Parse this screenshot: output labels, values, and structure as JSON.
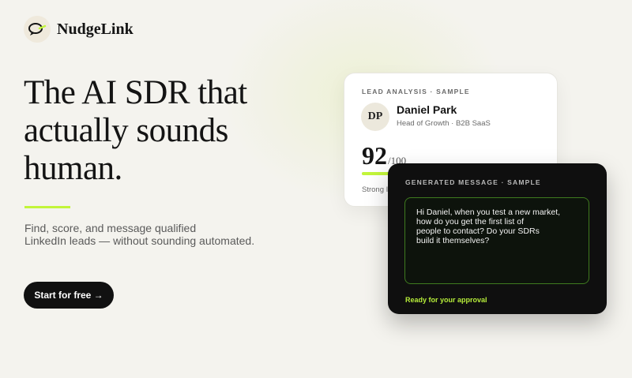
{
  "brand": {
    "name": "NudgeLink",
    "logo_icon": "chat-bubble-icon",
    "accent": "#c2f53a"
  },
  "hero": {
    "headline_lines": [
      "The AI SDR that",
      "actually sounds",
      "human."
    ],
    "subhead_lines": [
      "Find, score, and message qualified",
      "LinkedIn leads — without sounding automated."
    ],
    "cta_label": "Start for free →"
  },
  "lead_card": {
    "label": "LEAD ANALYSIS · SAMPLE",
    "avatar_initials": "DP",
    "name": "Daniel Park",
    "title": "Head of Growth · B2B SaaS",
    "score": "92",
    "score_max": "/100",
    "score_fraction": 0.92,
    "status": "Strong I"
  },
  "message_card": {
    "label": "GENERATED MESSAGE · SAMPLE",
    "message_lines": [
      "Hi Daniel, when you test a new market,",
      "how do you get the first list of",
      "people to contact? Do your SDRs",
      "build it themselves?"
    ],
    "status": "Ready for your approval",
    "status_color": "#b7ee3a"
  }
}
